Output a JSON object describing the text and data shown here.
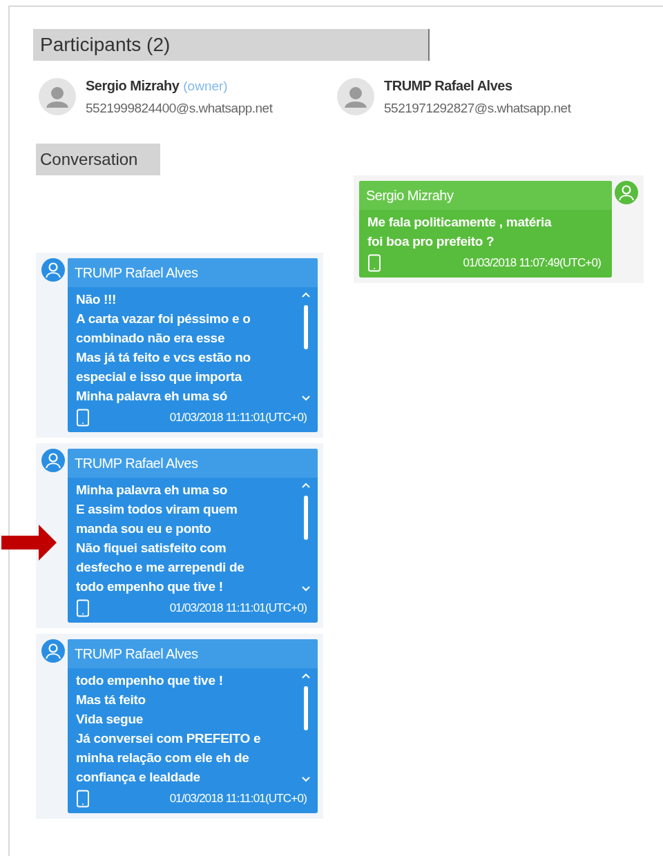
{
  "participants": {
    "title": "Participants (2)",
    "items": [
      {
        "name": "Sergio Mizrahy",
        "role": "(owner)",
        "address": "5521999824400@s.whatsapp.net"
      },
      {
        "name": "TRUMP Rafael Alves",
        "address": "5521971292827@s.whatsapp.net"
      }
    ]
  },
  "conversation": {
    "title": "Conversation",
    "messages": [
      {
        "kind": "outgoing",
        "sender": "Sergio Mizrahy",
        "lines": [
          "Me fala politicamente , matéria",
          "foi boa pro prefeito ?"
        ],
        "timestamp": "01/03/2018 11:07:49(UTC+0)"
      },
      {
        "kind": "incoming",
        "sender": "TRUMP Rafael Alves",
        "lines": [
          "Não !!!",
          "A carta vazar foi péssimo e o",
          "combinado não era esse",
          "Mas já tá feito e vcs estão no",
          "especial e isso que importa",
          "Minha palavra eh uma só"
        ],
        "timestamp": "01/03/2018 11:11:01(UTC+0)"
      },
      {
        "kind": "incoming",
        "sender": "TRUMP Rafael Alves",
        "lines": [
          "Minha palavra eh uma so",
          "E assim todos viram quem",
          "manda sou eu e ponto",
          "Não fiquei satisfeito com",
          "desfecho e me arrependi de",
          "todo empenho que tive !"
        ],
        "timestamp": "01/03/2018 11:11:01(UTC+0)"
      },
      {
        "kind": "incoming",
        "sender": "TRUMP Rafael Alves",
        "lines": [
          "todo empenho que tive !",
          "Mas tá feito",
          "Vida segue",
          "Já conversei com PREFEITO e",
          "minha relação com ele eh de",
          "confiança e lealdade"
        ],
        "timestamp": "01/03/2018 11:11:01(UTC+0)"
      }
    ]
  }
}
